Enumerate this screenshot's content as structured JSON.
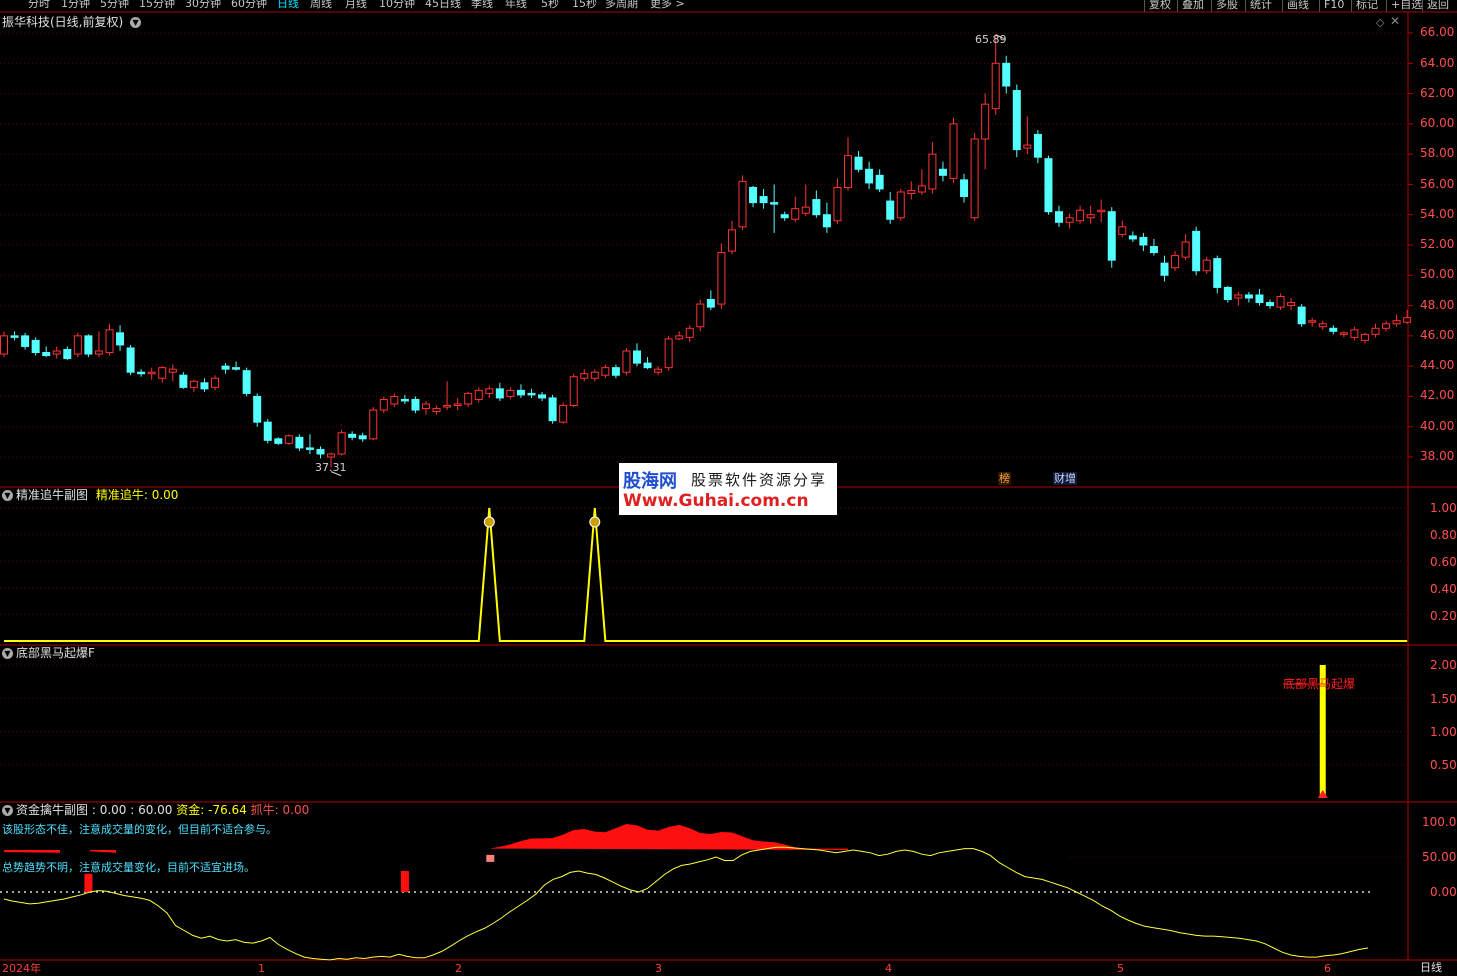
{
  "app": {
    "period_tabs": [
      "分时",
      "1分钟",
      "5分钟",
      "15分钟",
      "30分钟",
      "60分钟",
      "日线",
      "周线",
      "月线",
      "10分钟",
      "45日线",
      "季线",
      "年线",
      "5秒",
      "15秒",
      "多周期",
      "更多 >"
    ],
    "active_tab": "日线",
    "right_buttons": [
      "复权",
      "叠加",
      "多股",
      "统计",
      "画线",
      "F10",
      "标记",
      "+自选",
      "返回"
    ]
  },
  "main_panel": {
    "title": "振华科技(日线,前复权)",
    "high_label": "65.89",
    "low_label": "37.31",
    "event_tags": [
      "榜",
      "财增"
    ],
    "y_ticks": [
      "66.00",
      "64.00",
      "62.00",
      "60.00",
      "58.00",
      "56.00",
      "54.00",
      "52.00",
      "50.00",
      "48.00",
      "46.00",
      "44.00",
      "42.00",
      "40.00",
      "38.00"
    ]
  },
  "watermark": {
    "site_name": "股海网",
    "slogan": "股票软件资源分享",
    "url": "Www.Guhai.com.cn"
  },
  "panel2": {
    "title": "精准追牛副图",
    "indicator": "精准追牛: 0.00",
    "y_ticks": [
      "1.00",
      "0.80",
      "0.60",
      "0.40",
      "0.20"
    ]
  },
  "panel3": {
    "title": "底部黑马起爆F",
    "signal_label": "底部黑马起爆",
    "y_ticks": [
      "2.00",
      "1.50",
      "1.00",
      "0.50"
    ]
  },
  "panel4": {
    "title": "资金擒牛副图",
    "values_text": ": 0.00 : 60.00",
    "fund_text": "资金: -76.64",
    "grab_text": "抓牛: 0.00",
    "note1": "该股形态不佳，注意成交量的变化，但目前不适合参与。",
    "note2": "总势趋势不明，注意成交量变化，目前不适宜进场。",
    "y_ticks": [
      "100.0",
      "50.00",
      "0.00"
    ]
  },
  "x_axis": {
    "labels": [
      "2024年",
      "1",
      "2",
      "3",
      "4",
      "5",
      "6"
    ],
    "period_label": "日线"
  },
  "colors": {
    "up": "#ff3232",
    "down": "#54ffff",
    "axis": "#b40000",
    "grid": "#5a0000",
    "signal": "#ffff00"
  },
  "chart_data": {
    "type": "candlestick",
    "title": "振华科技(日线,前复权)",
    "ylim": [
      37,
      66.5
    ],
    "high": 65.89,
    "low": 37.31,
    "candles": [
      {
        "o": 44.8,
        "h": 46.3,
        "l": 44.6,
        "c": 46.0
      },
      {
        "o": 46.0,
        "h": 46.3,
        "l": 45.7,
        "c": 45.9
      },
      {
        "o": 46.0,
        "h": 46.2,
        "l": 45.1,
        "c": 45.3
      },
      {
        "o": 45.7,
        "h": 45.9,
        "l": 44.7,
        "c": 44.9
      },
      {
        "o": 44.9,
        "h": 45.3,
        "l": 44.6,
        "c": 44.7
      },
      {
        "o": 44.8,
        "h": 45.3,
        "l": 44.5,
        "c": 45.0
      },
      {
        "o": 45.1,
        "h": 45.3,
        "l": 44.4,
        "c": 44.5
      },
      {
        "o": 44.8,
        "h": 46.2,
        "l": 44.6,
        "c": 46.0
      },
      {
        "o": 46.0,
        "h": 46.1,
        "l": 44.6,
        "c": 44.8
      },
      {
        "o": 44.8,
        "h": 46.3,
        "l": 44.6,
        "c": 45.0
      },
      {
        "o": 44.9,
        "h": 46.8,
        "l": 44.7,
        "c": 46.4
      },
      {
        "o": 46.2,
        "h": 46.7,
        "l": 45.0,
        "c": 45.4
      },
      {
        "o": 45.2,
        "h": 45.4,
        "l": 43.4,
        "c": 43.6
      },
      {
        "o": 43.6,
        "h": 43.8,
        "l": 43.3,
        "c": 43.5
      },
      {
        "o": 43.5,
        "h": 43.9,
        "l": 43.1,
        "c": 43.6
      },
      {
        "o": 43.2,
        "h": 44.0,
        "l": 42.9,
        "c": 43.9
      },
      {
        "o": 43.6,
        "h": 44.1,
        "l": 43.0,
        "c": 43.8
      },
      {
        "o": 43.4,
        "h": 43.6,
        "l": 42.5,
        "c": 42.6
      },
      {
        "o": 42.6,
        "h": 43.1,
        "l": 42.3,
        "c": 43.0
      },
      {
        "o": 42.9,
        "h": 43.2,
        "l": 42.3,
        "c": 42.5
      },
      {
        "o": 42.6,
        "h": 43.4,
        "l": 42.4,
        "c": 43.2
      },
      {
        "o": 44.0,
        "h": 44.2,
        "l": 43.5,
        "c": 43.8
      },
      {
        "o": 43.9,
        "h": 44.3,
        "l": 43.7,
        "c": 43.8
      },
      {
        "o": 43.7,
        "h": 43.9,
        "l": 42.0,
        "c": 42.2
      },
      {
        "o": 42.0,
        "h": 42.2,
        "l": 40.0,
        "c": 40.3
      },
      {
        "o": 40.3,
        "h": 40.5,
        "l": 38.9,
        "c": 39.1
      },
      {
        "o": 39.2,
        "h": 39.3,
        "l": 38.8,
        "c": 38.9
      },
      {
        "o": 38.9,
        "h": 39.5,
        "l": 38.8,
        "c": 39.4
      },
      {
        "o": 39.3,
        "h": 39.5,
        "l": 38.4,
        "c": 38.6
      },
      {
        "o": 38.6,
        "h": 39.5,
        "l": 38.2,
        "c": 38.5
      },
      {
        "o": 38.5,
        "h": 38.7,
        "l": 37.9,
        "c": 38.2
      },
      {
        "o": 38.0,
        "h": 38.3,
        "l": 37.3,
        "c": 38.2
      },
      {
        "o": 38.2,
        "h": 39.8,
        "l": 38.1,
        "c": 39.6
      },
      {
        "o": 39.5,
        "h": 39.7,
        "l": 39.1,
        "c": 39.3
      },
      {
        "o": 39.4,
        "h": 39.6,
        "l": 39.0,
        "c": 39.2
      },
      {
        "o": 39.2,
        "h": 41.3,
        "l": 39.1,
        "c": 41.1
      },
      {
        "o": 41.1,
        "h": 42.0,
        "l": 40.9,
        "c": 41.8
      },
      {
        "o": 41.5,
        "h": 42.2,
        "l": 41.3,
        "c": 42.0
      },
      {
        "o": 41.8,
        "h": 42.1,
        "l": 41.5,
        "c": 41.7
      },
      {
        "o": 41.8,
        "h": 42.0,
        "l": 40.9,
        "c": 41.1
      },
      {
        "o": 41.2,
        "h": 41.7,
        "l": 40.8,
        "c": 41.5
      },
      {
        "o": 41.0,
        "h": 41.4,
        "l": 40.8,
        "c": 41.2
      },
      {
        "o": 41.3,
        "h": 43.0,
        "l": 41.1,
        "c": 41.4
      },
      {
        "o": 41.4,
        "h": 41.9,
        "l": 41.1,
        "c": 41.5
      },
      {
        "o": 41.5,
        "h": 42.3,
        "l": 41.3,
        "c": 42.2
      },
      {
        "o": 41.8,
        "h": 42.6,
        "l": 41.6,
        "c": 42.4
      },
      {
        "o": 42.2,
        "h": 42.7,
        "l": 41.9,
        "c": 42.5
      },
      {
        "o": 42.5,
        "h": 42.9,
        "l": 41.7,
        "c": 41.9
      },
      {
        "o": 42.0,
        "h": 42.6,
        "l": 41.8,
        "c": 42.4
      },
      {
        "o": 42.4,
        "h": 42.8,
        "l": 41.9,
        "c": 42.1
      },
      {
        "o": 42.2,
        "h": 42.5,
        "l": 41.9,
        "c": 42.1
      },
      {
        "o": 42.1,
        "h": 42.3,
        "l": 41.7,
        "c": 41.9
      },
      {
        "o": 41.9,
        "h": 42.1,
        "l": 40.2,
        "c": 40.4
      },
      {
        "o": 40.3,
        "h": 41.6,
        "l": 40.2,
        "c": 41.4
      },
      {
        "o": 41.4,
        "h": 43.5,
        "l": 41.3,
        "c": 43.3
      },
      {
        "o": 43.2,
        "h": 43.8,
        "l": 43.0,
        "c": 43.5
      },
      {
        "o": 43.2,
        "h": 43.8,
        "l": 43.0,
        "c": 43.6
      },
      {
        "o": 43.4,
        "h": 44.1,
        "l": 43.2,
        "c": 43.9
      },
      {
        "o": 43.9,
        "h": 44.1,
        "l": 43.2,
        "c": 43.4
      },
      {
        "o": 43.6,
        "h": 45.2,
        "l": 43.4,
        "c": 45.0
      },
      {
        "o": 45.0,
        "h": 45.5,
        "l": 44.0,
        "c": 44.2
      },
      {
        "o": 44.2,
        "h": 44.6,
        "l": 43.8,
        "c": 43.9
      },
      {
        "o": 43.6,
        "h": 44.0,
        "l": 43.4,
        "c": 43.8
      },
      {
        "o": 43.9,
        "h": 46.0,
        "l": 43.7,
        "c": 45.8
      },
      {
        "o": 45.8,
        "h": 46.3,
        "l": 45.7,
        "c": 46.0
      },
      {
        "o": 45.9,
        "h": 46.7,
        "l": 45.6,
        "c": 46.5
      },
      {
        "o": 46.6,
        "h": 48.4,
        "l": 46.3,
        "c": 48.1
      },
      {
        "o": 48.4,
        "h": 49.0,
        "l": 47.7,
        "c": 47.9
      },
      {
        "o": 48.1,
        "h": 52.1,
        "l": 47.8,
        "c": 51.5
      },
      {
        "o": 51.6,
        "h": 53.6,
        "l": 51.4,
        "c": 53.0
      },
      {
        "o": 53.2,
        "h": 56.6,
        "l": 53.0,
        "c": 56.2
      },
      {
        "o": 55.8,
        "h": 55.9,
        "l": 54.5,
        "c": 54.8
      },
      {
        "o": 55.2,
        "h": 55.7,
        "l": 54.4,
        "c": 54.8
      },
      {
        "o": 54.8,
        "h": 56.0,
        "l": 52.8,
        "c": 54.7
      },
      {
        "o": 54.0,
        "h": 54.2,
        "l": 53.6,
        "c": 53.8
      },
      {
        "o": 53.7,
        "h": 55.2,
        "l": 53.5,
        "c": 54.4
      },
      {
        "o": 54.1,
        "h": 56.0,
        "l": 53.9,
        "c": 54.5
      },
      {
        "o": 55.0,
        "h": 55.6,
        "l": 53.8,
        "c": 54.0
      },
      {
        "o": 54.0,
        "h": 54.8,
        "l": 52.8,
        "c": 53.2
      },
      {
        "o": 53.6,
        "h": 56.4,
        "l": 53.4,
        "c": 55.8
      },
      {
        "o": 55.8,
        "h": 59.1,
        "l": 55.6,
        "c": 57.9
      },
      {
        "o": 57.8,
        "h": 58.2,
        "l": 56.8,
        "c": 57.0
      },
      {
        "o": 57.0,
        "h": 57.5,
        "l": 55.7,
        "c": 56.1
      },
      {
        "o": 56.6,
        "h": 57.0,
        "l": 55.5,
        "c": 55.7
      },
      {
        "o": 54.9,
        "h": 55.5,
        "l": 53.4,
        "c": 53.7
      },
      {
        "o": 53.8,
        "h": 55.7,
        "l": 53.6,
        "c": 55.5
      },
      {
        "o": 55.4,
        "h": 56.2,
        "l": 55.0,
        "c": 55.6
      },
      {
        "o": 55.5,
        "h": 57.0,
        "l": 55.3,
        "c": 55.9
      },
      {
        "o": 55.7,
        "h": 58.8,
        "l": 55.4,
        "c": 58.0
      },
      {
        "o": 57.0,
        "h": 57.5,
        "l": 56.2,
        "c": 56.6
      },
      {
        "o": 56.4,
        "h": 60.4,
        "l": 56.1,
        "c": 60.0
      },
      {
        "o": 56.3,
        "h": 56.7,
        "l": 54.8,
        "c": 55.2
      },
      {
        "o": 53.8,
        "h": 59.4,
        "l": 53.6,
        "c": 59.0
      },
      {
        "o": 59.0,
        "h": 62.0,
        "l": 57.0,
        "c": 61.3
      },
      {
        "o": 61.0,
        "h": 65.9,
        "l": 60.6,
        "c": 64.0
      },
      {
        "o": 64.0,
        "h": 64.5,
        "l": 62.0,
        "c": 62.5
      },
      {
        "o": 62.2,
        "h": 62.6,
        "l": 57.8,
        "c": 58.3
      },
      {
        "o": 58.4,
        "h": 60.5,
        "l": 58.0,
        "c": 58.6
      },
      {
        "o": 59.3,
        "h": 59.6,
        "l": 57.4,
        "c": 57.8
      },
      {
        "o": 57.7,
        "h": 57.9,
        "l": 54.0,
        "c": 54.2
      },
      {
        "o": 54.2,
        "h": 54.6,
        "l": 53.2,
        "c": 53.5
      },
      {
        "o": 53.5,
        "h": 54.1,
        "l": 53.1,
        "c": 53.8
      },
      {
        "o": 53.6,
        "h": 54.6,
        "l": 53.4,
        "c": 54.3
      },
      {
        "o": 53.8,
        "h": 54.6,
        "l": 53.4,
        "c": 54.0
      },
      {
        "o": 54.2,
        "h": 55.0,
        "l": 53.5,
        "c": 54.3
      },
      {
        "o": 54.2,
        "h": 54.5,
        "l": 50.5,
        "c": 51.0
      },
      {
        "o": 52.7,
        "h": 53.6,
        "l": 52.5,
        "c": 53.2
      },
      {
        "o": 52.6,
        "h": 52.9,
        "l": 52.2,
        "c": 52.4
      },
      {
        "o": 52.5,
        "h": 52.8,
        "l": 51.6,
        "c": 52.0
      },
      {
        "o": 51.9,
        "h": 52.4,
        "l": 51.3,
        "c": 51.5
      },
      {
        "o": 50.8,
        "h": 51.3,
        "l": 49.6,
        "c": 50.0
      },
      {
        "o": 50.5,
        "h": 51.6,
        "l": 50.3,
        "c": 51.3
      },
      {
        "o": 51.2,
        "h": 52.7,
        "l": 51.0,
        "c": 52.2
      },
      {
        "o": 52.9,
        "h": 53.2,
        "l": 50.0,
        "c": 50.3
      },
      {
        "o": 50.3,
        "h": 51.2,
        "l": 50.1,
        "c": 51.0
      },
      {
        "o": 51.1,
        "h": 51.3,
        "l": 48.8,
        "c": 49.2
      },
      {
        "o": 49.2,
        "h": 49.3,
        "l": 48.2,
        "c": 48.4
      },
      {
        "o": 48.5,
        "h": 48.9,
        "l": 48.0,
        "c": 48.7
      },
      {
        "o": 48.7,
        "h": 48.9,
        "l": 48.2,
        "c": 48.5
      },
      {
        "o": 48.7,
        "h": 49.1,
        "l": 48.0,
        "c": 48.2
      },
      {
        "o": 48.2,
        "h": 48.4,
        "l": 47.8,
        "c": 48.0
      },
      {
        "o": 47.9,
        "h": 48.8,
        "l": 47.7,
        "c": 48.6
      },
      {
        "o": 48.0,
        "h": 48.5,
        "l": 47.7,
        "c": 48.2
      },
      {
        "o": 47.9,
        "h": 48.1,
        "l": 46.6,
        "c": 46.8
      },
      {
        "o": 46.9,
        "h": 47.2,
        "l": 46.6,
        "c": 47.0
      },
      {
        "o": 46.6,
        "h": 47.0,
        "l": 46.4,
        "c": 46.8
      },
      {
        "o": 46.5,
        "h": 46.7,
        "l": 46.1,
        "c": 46.3
      },
      {
        "o": 46.1,
        "h": 46.3,
        "l": 45.9,
        "c": 46.2
      },
      {
        "o": 45.9,
        "h": 46.6,
        "l": 45.7,
        "c": 46.4
      },
      {
        "o": 45.7,
        "h": 46.2,
        "l": 45.5,
        "c": 46.1
      },
      {
        "o": 46.1,
        "h": 46.8,
        "l": 45.9,
        "c": 46.5
      },
      {
        "o": 46.5,
        "h": 47.0,
        "l": 46.3,
        "c": 46.8
      },
      {
        "o": 46.8,
        "h": 47.4,
        "l": 46.6,
        "c": 47.0
      },
      {
        "o": 46.9,
        "h": 47.7,
        "l": 46.8,
        "c": 47.2
      }
    ],
    "panel2_signal": {
      "spike_index": [
        46,
        56
      ],
      "value": 1.0,
      "baseline": 0.0
    },
    "panel3_signal": {
      "index": 125,
      "value": 2.0
    },
    "panel4_fund_curve": [
      -10,
      -13,
      -15,
      -17,
      -16,
      -14,
      -12,
      -10,
      -7,
      -4,
      0,
      2,
      1,
      -2,
      -5,
      -7,
      -9,
      -12,
      -20,
      -30,
      -48,
      -55,
      -62,
      -66,
      -63,
      -68,
      -70,
      -68,
      -72,
      -73,
      -70,
      -65,
      -75,
      -82,
      -88,
      -93,
      -95,
      -96,
      -97,
      -95,
      -96,
      -94,
      -95,
      -93,
      -92,
      -93,
      -89,
      -92,
      -94,
      -94,
      -90,
      -85,
      -78,
      -70,
      -63,
      -57,
      -52,
      -45,
      -37,
      -28,
      -20,
      -12,
      -3,
      10,
      18,
      22,
      28,
      30,
      27,
      25,
      20,
      14,
      8,
      3,
      0,
      5,
      15,
      25,
      33,
      38,
      40,
      43,
      46,
      50,
      45,
      45,
      53,
      58,
      60,
      62,
      64,
      64,
      63,
      62,
      61,
      60,
      58,
      56,
      58,
      60,
      58,
      56,
      52,
      54,
      58,
      60,
      58,
      54,
      52,
      56,
      58,
      60,
      62,
      62,
      58,
      52,
      42,
      35,
      28,
      22,
      20,
      18,
      14,
      10,
      6,
      0,
      -6,
      -12,
      -20,
      -26,
      -34,
      -40,
      -45,
      -49,
      -51,
      -53,
      -55,
      -58,
      -60,
      -62,
      -63,
      -63,
      -64,
      -65,
      -66,
      -68,
      -70,
      -74,
      -80,
      -86,
      -90,
      -92,
      -93,
      -93,
      -91,
      -90,
      -88,
      -85,
      -82,
      -80
    ],
    "panel4_bars": [
      {
        "index": 8,
        "value": 26
      },
      {
        "index": 38,
        "value": 30
      }
    ],
    "panel4_red_area": {
      "start_index": 46,
      "end_index": 80,
      "peak": 98
    }
  }
}
